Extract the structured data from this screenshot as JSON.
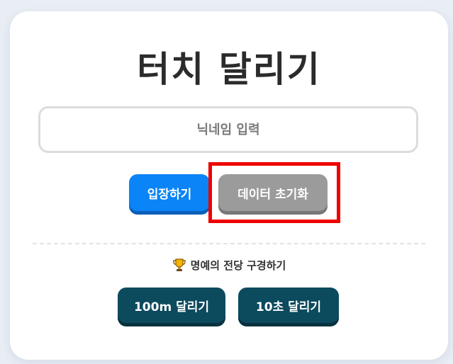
{
  "app": {
    "title": "터치 달리기"
  },
  "nickname": {
    "placeholder": "닉네임 입력",
    "value": ""
  },
  "actions": {
    "enter_label": "입장하기",
    "reset_label": "데이터 초기화"
  },
  "hall_of_fame": {
    "icon": "trophy-icon",
    "label": "명예의 전당 구경하기",
    "buttons": [
      {
        "label": "100m 달리기"
      },
      {
        "label": "10초 달리기"
      }
    ]
  },
  "colors": {
    "enter_button": "#0a84f6",
    "reset_button": "#9b9b9b",
    "dark_button": "#0c4a5e",
    "highlight": "#ee0000"
  }
}
